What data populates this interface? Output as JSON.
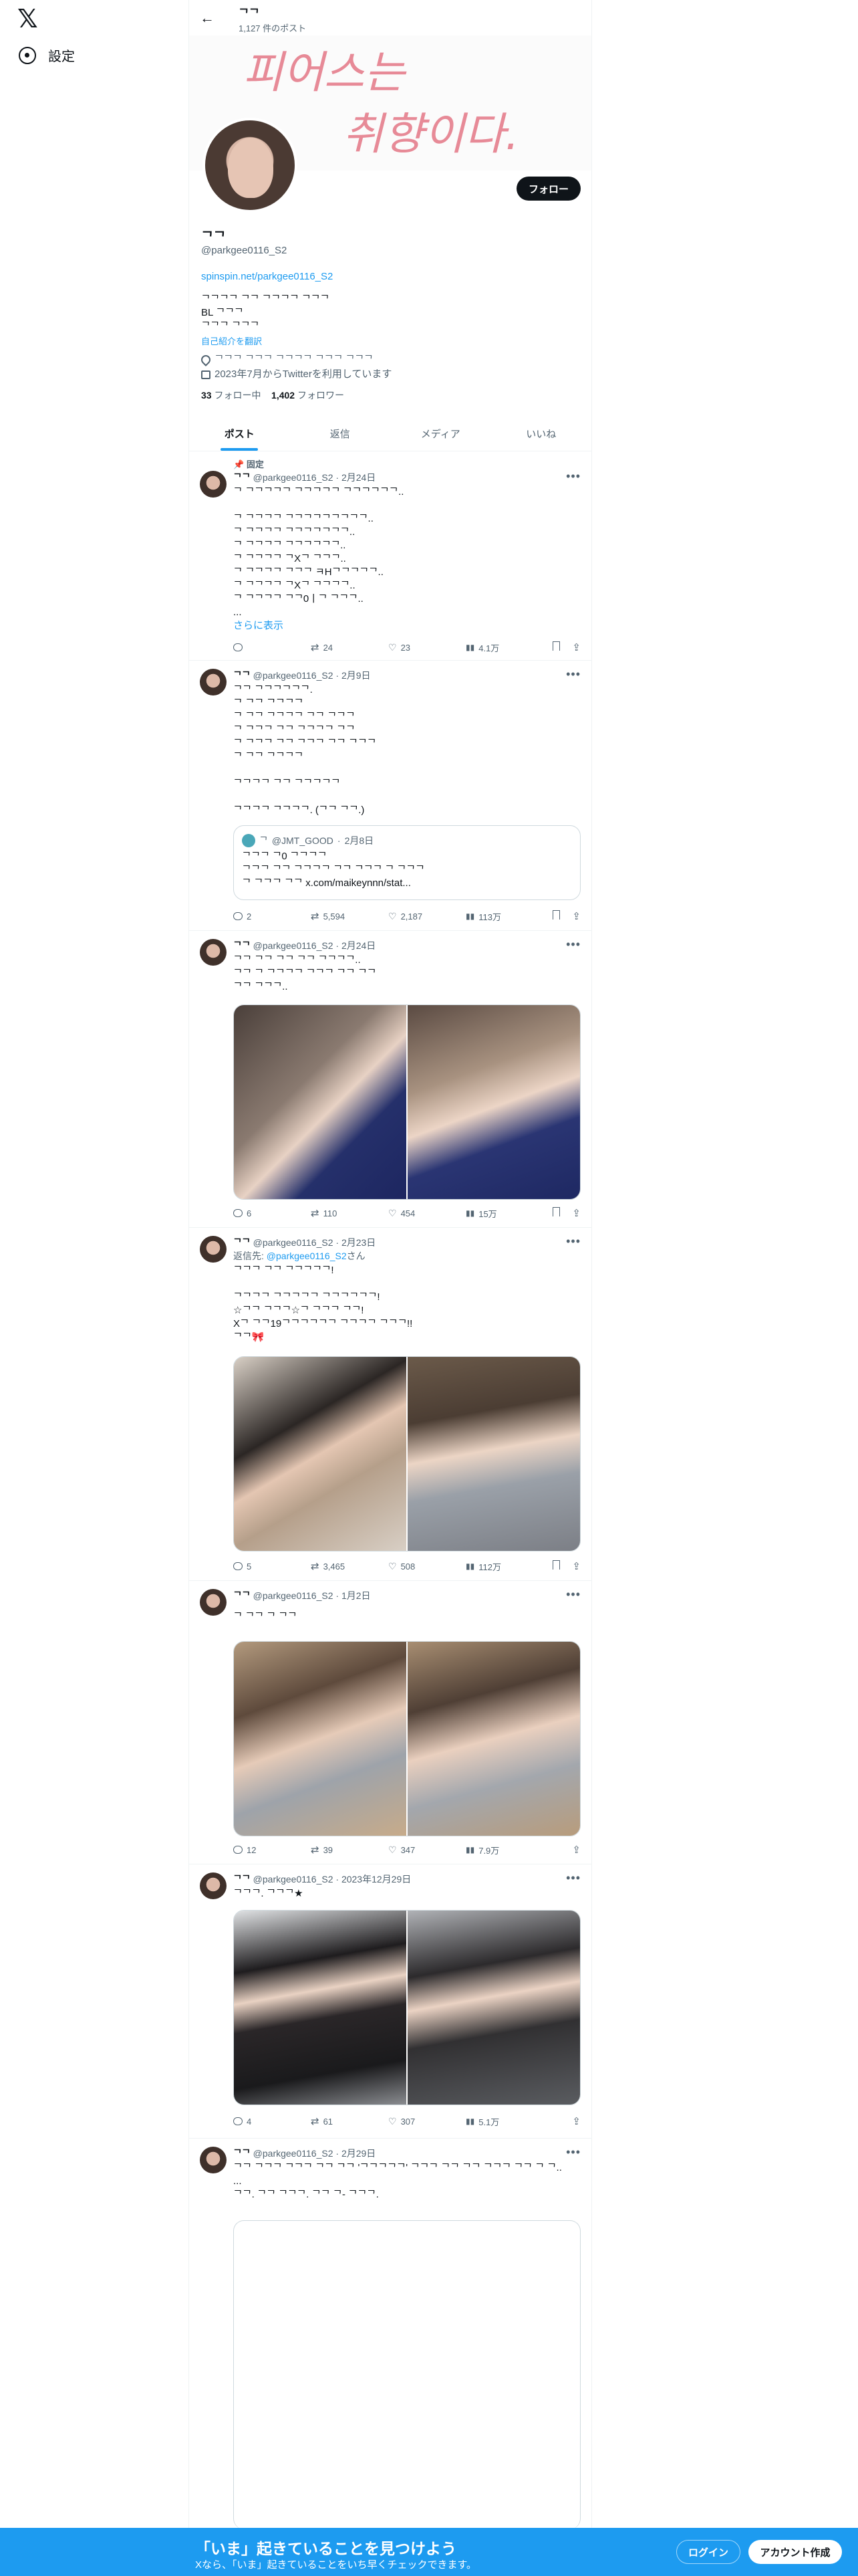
{
  "nav": {
    "logo": "𝕏",
    "settings_label": "設定"
  },
  "header": {
    "name": "ᄀᄀ",
    "post_count": "1,127 件のポスト"
  },
  "banner": {
    "text_line1": "피어스는",
    "text_line2": "취향이다."
  },
  "profile": {
    "name": "ᄀᄀ",
    "handle": "@parkgee0116_S2",
    "link": "spinspin.net/parkgee0116_S2",
    "bio_line1": "ᄀᄀᄀᄀ ᄀᄀ ᄀᄀᄀᄀ ᄀᄀᄀ",
    "bio_line2": "BL ᄀᄀᄀ",
    "bio_line3": "ᄀᄀᄀ ᄀᄀᄀ",
    "translate": "自己紹介を翻訳",
    "location": "ᄀᄀᄀ ᄀᄀᄀ ᄀᄀᄀᄀ ᄀᄀᄀ ᄀᄀᄀ",
    "joined": "2023年7月からTwitterを利用しています",
    "following_count": "33",
    "following_label": "フォロー中",
    "followers_count": "1,402",
    "followers_label": "フォロワー",
    "follow_button": "フォロー"
  },
  "tabs": [
    "ポスト",
    "返信",
    "メディア",
    "いいね"
  ],
  "posts": [
    {
      "pinned": "固定",
      "author": "ᄀᄀ",
      "handle": "@parkgee0116_S2",
      "date": "2月24日",
      "text": "ᄀ ᄀᄀᄀᄀᄀ ᄀᄀᄀᄀᄀ ᄀᄀᄀᄀᄀᄀ..\n\nᄀ ᄀᄀᄀᄀ ᄀᄀᄀᄀᄀᄀᄀᄀᄀ..\nᄀ ᄀᄀᄀᄀ ᄀᄀᄀᄀᄀᄀᄀ..\nᄀ ᄀᄀᄀᄀ ᄀᄀᄀᄀᄀᄀ..\nᄀ ᄀᄀᄀᄀ ᄀXᄀ ᄀᄀᄀ..\nᄀ ᄀᄀᄀᄀ ᄀᄀᄀ ㅋHᄀᄀᄀᄀᄀ..\nᄀ ᄀᄀᄀᄀ ᄀXᄀ ᄀᄀᄀᄀ..\nᄀ ᄀᄀᄀᄀ ᄀᄀ0ㅣᄀ ᄀᄀᄀ..\n...",
      "show_more": "さらに表示",
      "replies": "",
      "retweets": "24",
      "likes": "23",
      "views": "4.1万"
    },
    {
      "author": "ᄀᄀ",
      "handle": "@parkgee0116_S2",
      "date": "2月9日",
      "text": "ᄀᄀ ᄀᄀᄀᄀᄀᄀ.\nᄀ ᄀᄀ ᄀᄀᄀᄀ\nᄀ ᄀᄀ ᄀᄀᄀᄀ ᄀᄀ ᄀᄀᄀ\nᄀ ᄀᄀᄀ ᄀᄀ ᄀᄀᄀᄀ ᄀᄀ\nᄀ ᄀᄀᄀ ᄀᄀ ᄀᄀᄀ ᄀᄀ ᄀᄀᄀ\nᄀ ᄀᄀ ᄀᄀᄀᄀ\n\nᄀᄀᄀᄀ ᄀᄀ ᄀᄀᄀᄀᄀ\n\nᄀᄀᄀᄀ ᄀᄀᄀᄀ. (ᄀᄀ ᄀᄀ.)",
      "quote": {
        "author": "ᄀ",
        "handle": "@JMT_GOOD",
        "date": "2月8日",
        "text": "ᄀᄀᄀ ᄀ0 ᄀᄀᄀᄀ\nᄀᄀᄀ ᄀᄀ ᄀᄀᄀᄀ ᄀᄀ ᄀᄀᄀ ᄀ ᄀᄀᄀ\nᄀ ᄀᄀᄀ ᄀᄀ x.com/maikeynnn/stat..."
      },
      "replies": "2",
      "retweets": "5,594",
      "likes": "2,187",
      "views": "113万"
    },
    {
      "author": "ᄀᄀ",
      "handle": "@parkgee0116_S2",
      "date": "2月24日",
      "text": "ᄀᄀ ᄀᄀ ᄀᄀ ᄀᄀ ᄀᄀᄀᄀ..\nᄀᄀ ᄀ ᄀᄀᄀᄀ ᄀᄀᄀ ᄀᄀ ᄀᄀ\nᄀᄀ ᄀᄀᄀ..",
      "replies": "6",
      "retweets": "110",
      "likes": "454",
      "views": "15万"
    },
    {
      "author": "ᄀᄀ",
      "handle": "@parkgee0116_S2",
      "date": "2月23日",
      "reply_to_label": "返信先:",
      "reply_to_handle": "@parkgee0116_S2",
      "reply_to_suffix": "さん",
      "text": "ᄀᄀᄀ ᄀᄀ ᄀᄀᄀᄀᄀ!\n\nᄀᄀᄀᄀ ᄀᄀᄀᄀᄀ ᄀᄀᄀᄀᄀᄀ!\n☆ᄀᄀ ᄀᄀᄀ☆ᄀ ᄀᄀᄀ ᄀᄀ!\nXᄀ ᄀᄀ19ᄀᄀᄀᄀᄀᄀ ᄀᄀᄀᄀ ᄀᄀᄀ!!\nᄀᄀ🎀",
      "replies": "5",
      "retweets": "3,465",
      "likes": "508",
      "views": "112万"
    },
    {
      "author": "ᄀᄀ",
      "handle": "@parkgee0116_S2",
      "date": "1月2日",
      "text": "ᄀ ᄀᄀ ᄀ ᄀᄀ",
      "replies": "12",
      "retweets": "39",
      "likes": "347",
      "views": "7.9万"
    },
    {
      "author": "ᄀᄀ",
      "handle": "@parkgee0116_S2",
      "date": "2023年12月29日",
      "text": "ᄀᄀᄀ.            ᄀᄀᄀ★",
      "replies": "4",
      "retweets": "61",
      "likes": "307",
      "views": "5.1万"
    },
    {
      "author": "ᄀᄀ",
      "handle": "@parkgee0116_S2",
      "date": "2月29日",
      "text": "ᄀᄀ ᄀᄀᄀ ᄀᄀᄀ ᄀᄀ ᄀᄀ 'ᄀᄀᄀᄀᄀ' ᄀᄀᄀ ᄀᄀ ᄀᄀ ᄀᄀᄀ ᄀᄀ ᄀ ᄀ..\n...\nᄀᄀ. ᄀᄀ ᄀᄀᄀ. ᄀᄀ ᄀ- ᄀᄀᄀ."
    }
  ],
  "bottom": {
    "title": "「いま」起きていることを見つけよう",
    "subtitle": "Xなら、「いま」起きていることをいち早くチェックできます。",
    "login": "ログイン",
    "signup": "アカウント作成"
  },
  "colors": {
    "accent": "#1d9bf0",
    "text": "#0f1419",
    "muted": "#536471"
  }
}
